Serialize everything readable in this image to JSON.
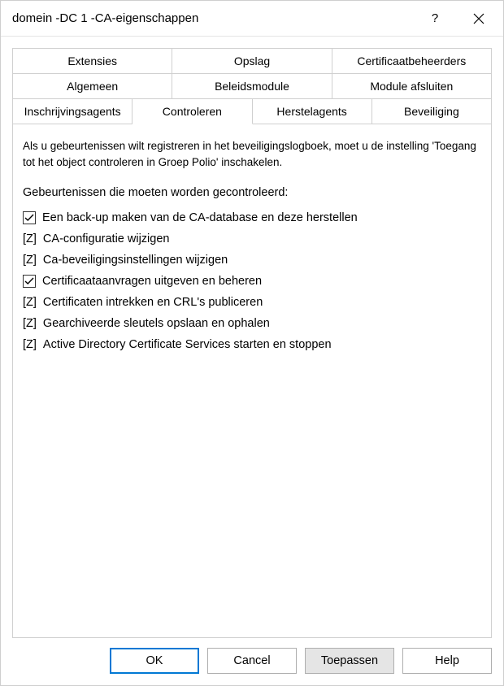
{
  "title": "domein -DC 1 -CA-eigenschappen",
  "titlebar": {
    "help_tooltip": "?",
    "close_tooltip": "Close"
  },
  "tabs": {
    "row1": [
      {
        "label": "Extensies"
      },
      {
        "label": "Opslag"
      },
      {
        "label": "Certificaatbeheerders"
      }
    ],
    "row2": [
      {
        "label": "Algemeen"
      },
      {
        "label": "Beleidsmodule"
      },
      {
        "label": "Module afsluiten"
      }
    ],
    "row3": [
      {
        "label": "Inschrijvingsagents"
      },
      {
        "label": "Controleren",
        "active": true
      },
      {
        "label": "Herstelagents"
      },
      {
        "label": "Beveiliging"
      }
    ]
  },
  "panel": {
    "info": "Als u gebeurtenissen wilt registreren in het beveiligingslogboek, moet u de instelling 'Toegang tot het object controleren in Groep Polio' inschakelen.",
    "group_label": "Gebeurtenissen die moeten worden gecontroleerd:",
    "items": [
      {
        "label": "Een back-up maken van de CA-database en deze herstellen",
        "state": "checked"
      },
      {
        "label": "CA-configuratie wijzigen",
        "state": "z"
      },
      {
        "label": "Ca-beveiligingsinstellingen wijzigen",
        "state": "z"
      },
      {
        "label": "Certificaataanvragen uitgeven en beheren",
        "state": "checked"
      },
      {
        "label": "Certificaten intrekken en CRL's publiceren",
        "state": "z"
      },
      {
        "label": "Gearchiveerde sleutels opslaan en ophalen",
        "state": "z"
      },
      {
        "label": "Active Directory Certificate Services starten en stoppen",
        "state": "z"
      }
    ],
    "z_marker": "[Z]"
  },
  "buttons": {
    "ok": "OK",
    "cancel": "Cancel",
    "apply": "Toepassen",
    "help": "Help"
  }
}
